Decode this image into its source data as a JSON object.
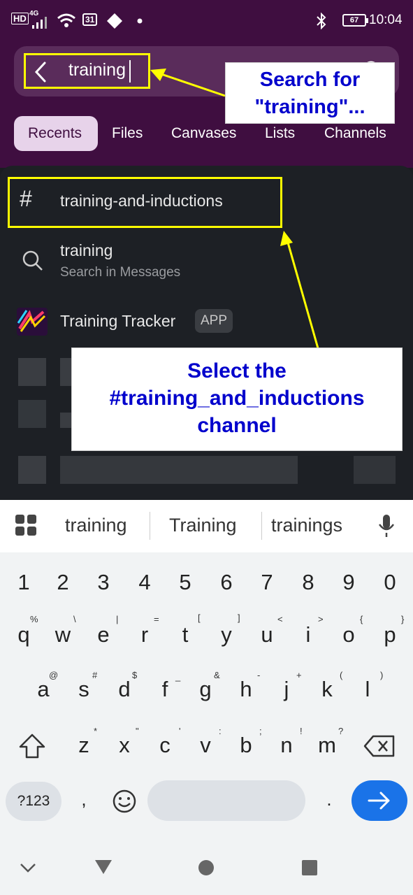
{
  "status": {
    "hd": "HD",
    "net": "4G",
    "cal": "31",
    "battery": "67",
    "time": "10:04"
  },
  "search": {
    "query": "training"
  },
  "tabs": [
    "Recents",
    "Files",
    "Canvases",
    "Lists",
    "Channels"
  ],
  "results": {
    "channel": "training-and-inductions",
    "search_term": "training",
    "search_hint": "Search in Messages",
    "app_name": "Training Tracker",
    "app_badge": "APP"
  },
  "callouts": {
    "search": "Search for \"training\"...",
    "select": "Select the #training_and_inductions channel"
  },
  "keyboard": {
    "suggestions": [
      "training",
      "Training",
      "trainings"
    ],
    "numbers": [
      "1",
      "2",
      "3",
      "4",
      "5",
      "6",
      "7",
      "8",
      "9",
      "0"
    ],
    "row1": [
      "q",
      "w",
      "e",
      "r",
      "t",
      "y",
      "u",
      "i",
      "o",
      "p"
    ],
    "row1_sup": [
      "%",
      "\\",
      "|",
      "=",
      "[",
      "]",
      "<",
      ">",
      "{",
      "}"
    ],
    "row2": [
      "a",
      "s",
      "d",
      "f",
      "g",
      "h",
      "j",
      "k",
      "l"
    ],
    "row2_sup": [
      "@",
      "#",
      "$",
      "_",
      "&",
      "-",
      "+",
      "(",
      ")"
    ],
    "row3": [
      "z",
      "x",
      "c",
      "v",
      "b",
      "n",
      "m"
    ],
    "row3_sup": [
      "*",
      "\"",
      "'",
      ":",
      ";",
      "!",
      "?"
    ],
    "sym": "?123",
    "comma": ",",
    "period": "."
  },
  "colors": {
    "header": "#3f0e40",
    "highlight": "#ffff00",
    "callout_text": "#0000cc",
    "enter": "#1a73e8"
  }
}
